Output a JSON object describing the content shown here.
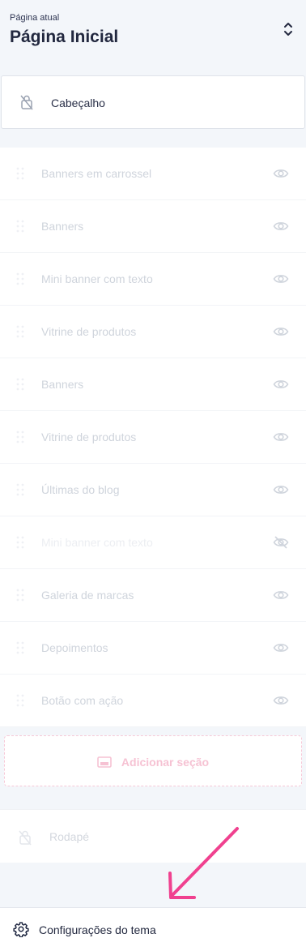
{
  "current_page": {
    "label": "Página atual",
    "title": "Página Inicial"
  },
  "header_section": {
    "label": "Cabeçalho"
  },
  "sections": [
    {
      "title": "Banners em carrossel",
      "visible": true
    },
    {
      "title": "Banners",
      "visible": true
    },
    {
      "title": "Mini banner com texto",
      "visible": true
    },
    {
      "title": "Vitrine de produtos",
      "visible": true
    },
    {
      "title": "Banners",
      "visible": true
    },
    {
      "title": "Vitrine de produtos",
      "visible": true
    },
    {
      "title": "Últimas do blog",
      "visible": true
    },
    {
      "title": "Mini banner com texto",
      "visible": false
    },
    {
      "title": "Galeria de marcas",
      "visible": true
    },
    {
      "title": "Depoimentos",
      "visible": true
    },
    {
      "title": "Botão com ação",
      "visible": true
    }
  ],
  "add_section": {
    "label": "Adicionar seção"
  },
  "footer_section": {
    "label": "Rodapé"
  },
  "theme_settings": {
    "label": "Configurações do tema"
  },
  "colors": {
    "accent_pink": "#f0418f",
    "background": "#f3f6fa",
    "muted_text": "#cfd4dc"
  },
  "icons": {
    "page_switch": "chevron-up-down-icon",
    "locked": "lock-icon",
    "drag": "drag-handle-icon",
    "visible": "eye-icon",
    "hidden": "eye-off-icon",
    "add": "image-icon",
    "settings": "gear-icon",
    "annotation": "arrow-icon"
  }
}
